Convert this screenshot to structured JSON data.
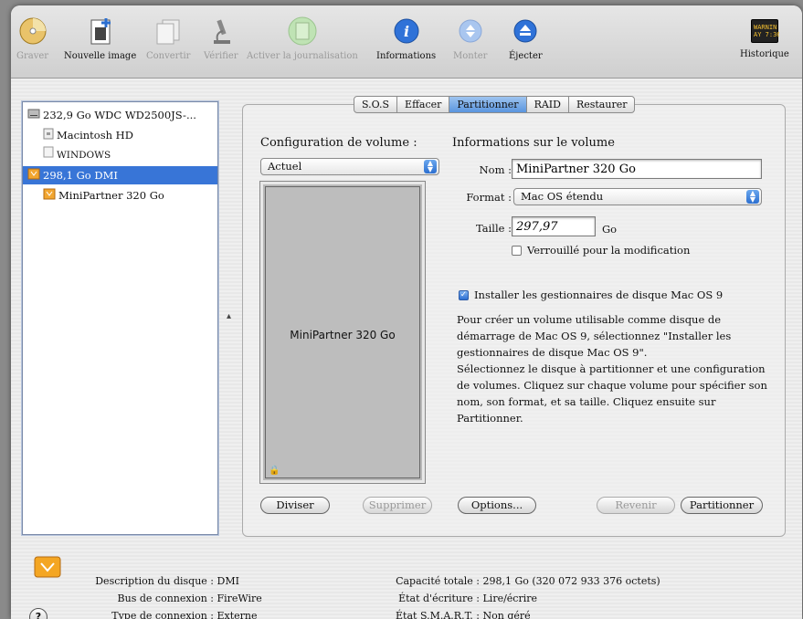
{
  "toolbar": {
    "items": [
      {
        "label": "Graver",
        "enabled": false
      },
      {
        "label": "Nouvelle image",
        "enabled": true
      },
      {
        "label": "Convertir",
        "enabled": false
      },
      {
        "label": "Vérifier",
        "enabled": false
      },
      {
        "label": "Activer la journalisation",
        "enabled": false
      },
      {
        "label": "Informations",
        "enabled": true
      },
      {
        "label": "Monter",
        "enabled": false
      },
      {
        "label": "Éjecter",
        "enabled": true
      },
      {
        "label": "Historique",
        "enabled": true
      }
    ],
    "log_icon_text": "WARNIN\nAY 7:36 A"
  },
  "sidebar": {
    "items": [
      {
        "label": "232,9 Go WDC WD2500JS-...",
        "level": 0,
        "icon": "internal-disk-icon",
        "selected": false
      },
      {
        "label": "Macintosh HD",
        "level": 1,
        "icon": "volume-icon",
        "selected": false
      },
      {
        "label": "WINDOWS",
        "level": 1,
        "icon": "volume-icon",
        "selected": false
      },
      {
        "label": "298,1 Go DMI",
        "level": 0,
        "icon": "firewire-disk-icon",
        "selected": true
      },
      {
        "label": "MiniPartner 320 Go",
        "level": 1,
        "icon": "firewire-volume-icon",
        "selected": false
      }
    ]
  },
  "tabs": [
    "S.O.S",
    "Effacer",
    "Partitionner",
    "RAID",
    "Restaurer"
  ],
  "active_tab": "Partitionner",
  "partition": {
    "config_heading": "Configuration de volume :",
    "config_popup": "Actuel",
    "volume_label": "MiniPartner 320 Go",
    "info_heading": "Informations sur le volume",
    "name_label": "Nom :",
    "name_value": "MiniPartner 320 Go",
    "format_label": "Format :",
    "format_value": "Mac OS étendu",
    "size_label": "Taille :",
    "size_value": "297,97",
    "size_unit": "Go",
    "locked_label": "Verrouillé pour la modification",
    "locked_checked": false,
    "install_label": "Installer les gestionnaires de disque Mac OS 9",
    "install_checked": true,
    "help_text_1": "Pour créer un volume utilisable comme disque de démarrage de Mac OS 9, sélectionnez \"Installer les gestionnaires de disque Mac OS 9\".",
    "help_text_2": "Sélectionnez le disque à partitionner et une configuration de volumes. Cliquez sur chaque volume pour spécifier son nom, son format, et sa taille. Cliquez ensuite sur Partitionner.",
    "buttons": {
      "split": "Diviser",
      "delete": "Supprimer",
      "options": "Options...",
      "revert": "Revenir",
      "partition": "Partitionner"
    }
  },
  "disk_info": {
    "desc_label": "Description du disque :",
    "desc_value": "DMI",
    "bus_label": "Bus de connexion :",
    "bus_value": "FireWire",
    "type_label": "Type de connexion :",
    "type_value": "Externe",
    "capacity_label": "Capacité totale :",
    "capacity_value": "298,1 Go (320 072 933 376 octets)",
    "write_label": "État d'écriture :",
    "write_value": "Lire/écrire",
    "smart_label": "État S.M.A.R.T. :",
    "smart_value": "Non géré"
  },
  "help_button": "?"
}
